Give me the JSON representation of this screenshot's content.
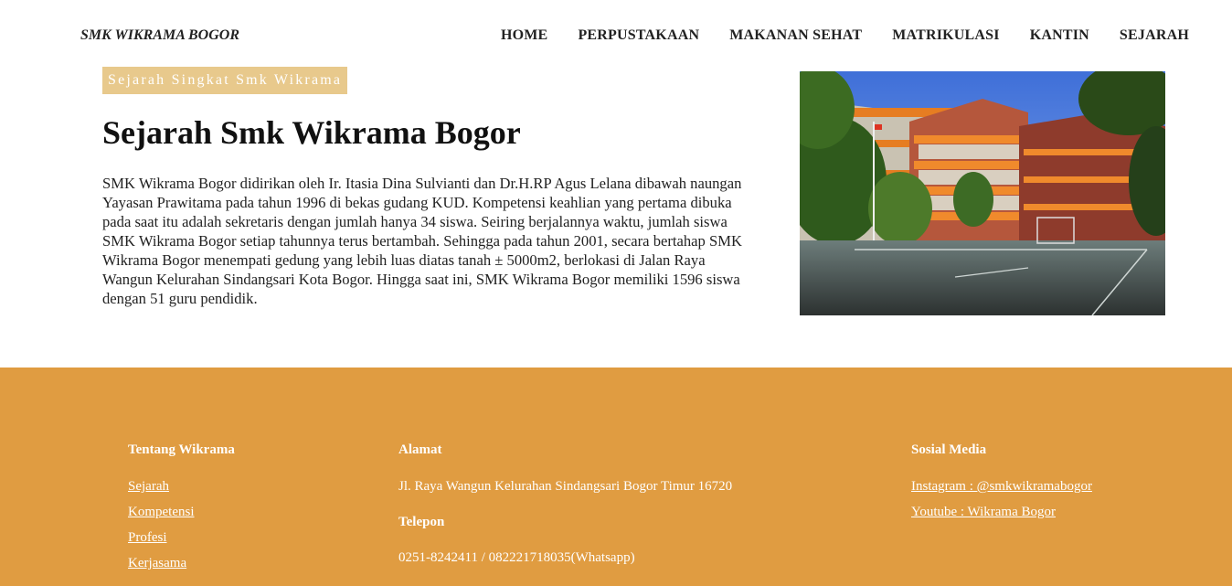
{
  "header": {
    "brand": "SMK WIKRAMA BOGOR",
    "nav": [
      "HOME",
      "PERPUSTAKAAN",
      "MAKANAN SEHAT",
      "MATRIKULASI",
      "KANTIN",
      "SEJARAH"
    ]
  },
  "main": {
    "badge": "Sejarah Singkat Smk Wikrama",
    "title": "Sejarah Smk Wikrama Bogor",
    "paragraph": "SMK Wikrama Bogor didirikan oleh Ir. Itasia Dina Sulvianti dan Dr.H.RP Agus Lelana dibawah naungan Yayasan Prawitama pada tahun 1996 di bekas gudang KUD. Kompetensi keahlian yang pertama dibuka pada saat itu adalah sekretaris dengan jumlah hanya 34 siswa. Seiring berjalannya waktu, jumlah siswa SMK Wikrama Bogor setiap tahunnya terus bertambah. Sehingga pada tahun 2001, secara bertahap SMK Wikrama Bogor menempati gedung yang lebih luas diatas tanah ± 5000m2, berlokasi di Jalan Raya Wangun Kelurahan Sindangsari Kota Bogor. Hingga saat ini, SMK Wikrama Bogor memiliki 1596 siswa dengan 51 guru pendidik."
  },
  "footer": {
    "about": {
      "heading": "Tentang Wikrama",
      "links": [
        "Sejarah",
        "Kompetensi",
        "Profesi",
        "Kerjasama"
      ]
    },
    "address": {
      "heading": "Alamat",
      "text": "Jl. Raya Wangun Kelurahan Sindangsari Bogor Timur 16720",
      "phone_heading": "Telepon",
      "phone": "0251-8242411 / 082221718035(Whatsapp)"
    },
    "social": {
      "heading": "Sosial Media",
      "items": [
        "Instagram : @smkwikramabogor",
        "Youtube : Wikrama Bogor"
      ]
    }
  },
  "colors": {
    "footer_bg": "#e09c41",
    "badge_bg": "#e8c98c"
  }
}
